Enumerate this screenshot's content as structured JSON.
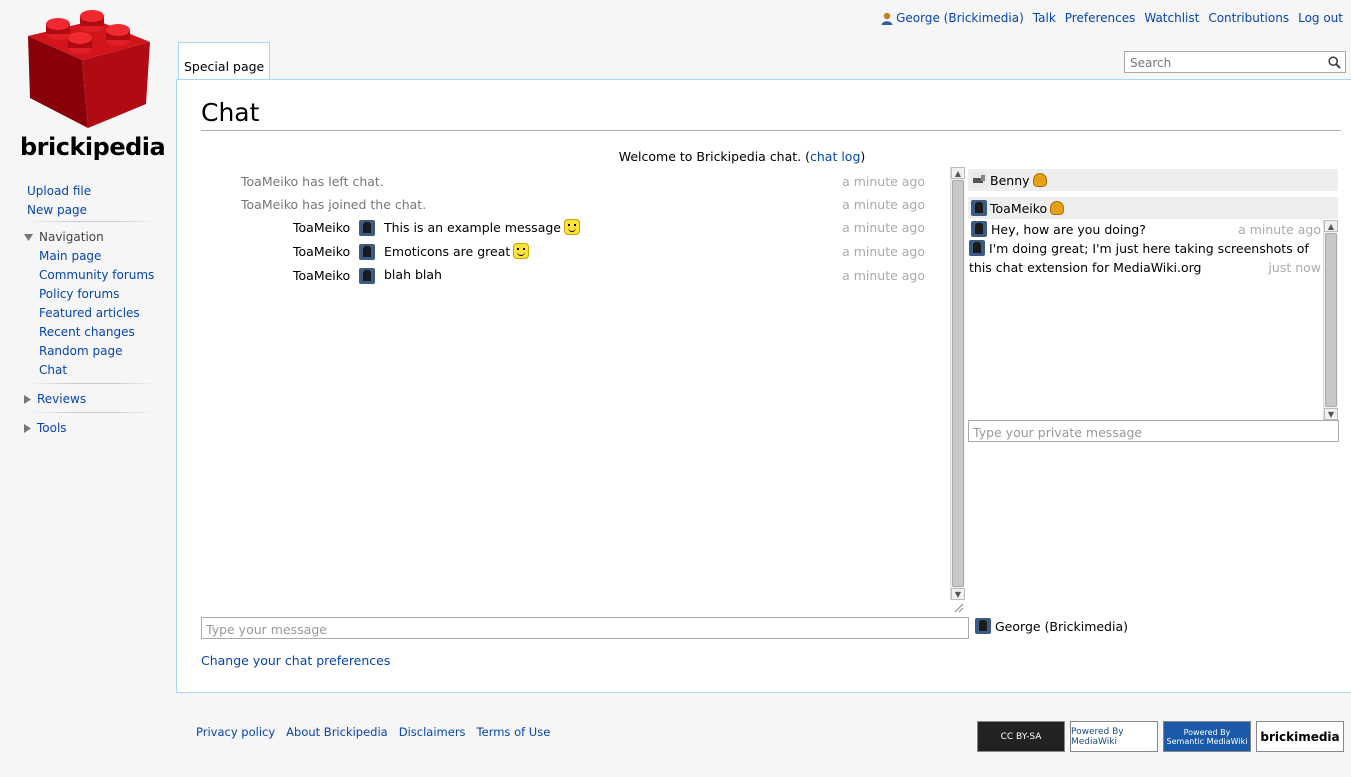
{
  "site": {
    "logo_text": "brickipedia"
  },
  "personal": {
    "user": "George (Brickimedia)",
    "links": [
      "Talk",
      "Preferences",
      "Watchlist",
      "Contributions",
      "Log out"
    ]
  },
  "tab": {
    "label": "Special page"
  },
  "search": {
    "placeholder": "Search"
  },
  "page": {
    "title": "Chat",
    "welcome_prefix": "Welcome to Brickipedia chat. (",
    "welcome_link": "chat log",
    "welcome_suffix": ")"
  },
  "sidebar": {
    "top": [
      "Upload file",
      "New page"
    ],
    "navigation_label": "Navigation",
    "navigation": [
      "Main page",
      "Community forums",
      "Policy forums",
      "Featured articles",
      "Recent changes",
      "Random page",
      "Chat"
    ],
    "reviews_label": "Reviews",
    "tools_label": "Tools"
  },
  "chat": {
    "system": [
      {
        "text": "ToaMeiko has left chat.",
        "time": "a minute ago"
      },
      {
        "text": "ToaMeiko has joined the chat.",
        "time": "a minute ago"
      }
    ],
    "messages": [
      {
        "user": "ToaMeiko",
        "text": "This is an example message",
        "emoticon": "laugh",
        "time": "a minute ago"
      },
      {
        "user": "ToaMeiko",
        "text": "Emoticons are great",
        "emoticon": "smile",
        "time": "a minute ago"
      },
      {
        "user": "ToaMeiko",
        "text": "blah blah",
        "emoticon": "",
        "time": "a minute ago"
      }
    ],
    "input_placeholder": "Type your message",
    "current_user": "George (Brickimedia)",
    "prefs_link": "Change your chat preferences"
  },
  "userlist": [
    "Benny",
    "ToaMeiko"
  ],
  "private": {
    "messages": [
      {
        "text": "Hey, how are you doing?",
        "time": "a minute ago"
      },
      {
        "text": "I'm doing great; I'm just here taking screenshots of this chat extension for MediaWiki.org",
        "time": "just now"
      }
    ],
    "input_placeholder": "Type your private message"
  },
  "footer": {
    "links": [
      "Privacy policy",
      "About Brickipedia",
      "Disclaimers",
      "Terms of Use"
    ],
    "badges": [
      "CC BY-SA",
      "Powered By MediaWiki",
      "Powered By Semantic MediaWiki",
      "brickimedia"
    ]
  },
  "colors": {
    "link": "#0645ad",
    "border": "#a7d7f9",
    "logo_red": "#c8101a"
  }
}
